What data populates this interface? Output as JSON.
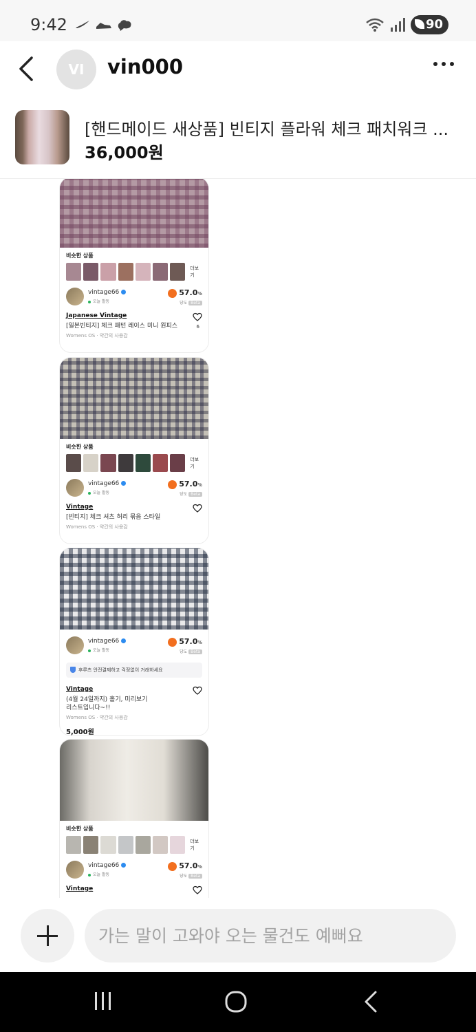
{
  "status_bar": {
    "time": "9:42",
    "app_icons": [
      "nike-icon",
      "nike-shoe-icon",
      "cloud-chat-icon"
    ],
    "battery": "90"
  },
  "header": {
    "avatar_initials": "VI",
    "username": "vin000"
  },
  "product": {
    "title": "[핸드메이드 새상품] 빈티지 플라워 체크 패치워크 ...",
    "price": "36,000원"
  },
  "cards": [
    {
      "similar_label": "비슷한 상품",
      "similar_more": "더보기",
      "similar_count": 7,
      "seller_name": "vintage66",
      "seller_active": "오늘 활동",
      "score": "57.0",
      "score_unit": "%",
      "grade_label": "당도",
      "beta_label": "Beta",
      "brand": "Japanese Vintage",
      "item_name": "[일본빈티지] 체크 패턴 레이스 미니 원피스",
      "meta": "Womens OS · 약간의 사용감",
      "likes": "6"
    },
    {
      "similar_label": "비슷한 상품",
      "similar_more": "더보기",
      "similar_count": 7,
      "seller_name": "vintage66",
      "seller_active": "오늘 활동",
      "score": "57.0",
      "score_unit": "%",
      "grade_label": "당도",
      "beta_label": "Beta",
      "brand": "Vintage",
      "item_name": "[빈티지] 체크 셔츠 허리 묶음 스타일",
      "meta": "Womens OS · 약간의 사용감"
    },
    {
      "seller_name": "vintage66",
      "seller_active": "오늘 활동",
      "score": "57.0",
      "score_unit": "%",
      "grade_label": "당도",
      "beta_label": "Beta",
      "safe_notice": "후루츠 안전결제하고 걱정없이 거래하세요",
      "brand": "Vintage",
      "item_name_line1": "(4월 24일까지) 홀기, 미리보기",
      "item_name_line2": "리스트입니다~!!",
      "meta": "Womens OS · 약간의 사용감",
      "price": "5,000원"
    },
    {
      "similar_label": "비슷한 상품",
      "similar_more": "더보기",
      "similar_count": 7,
      "seller_name": "vintage66",
      "seller_active": "오늘 활동",
      "score": "57.0",
      "score_unit": "%",
      "grade_label": "당도",
      "beta_label": "Beta",
      "brand": "Vintage"
    }
  ],
  "input": {
    "placeholder": "가는 말이 고와야 오는 물건도 예뻐요"
  },
  "colors": {
    "accent_peach": "#f26f1f",
    "active_green": "#29b35c",
    "verified_blue": "#2d8cf0"
  }
}
